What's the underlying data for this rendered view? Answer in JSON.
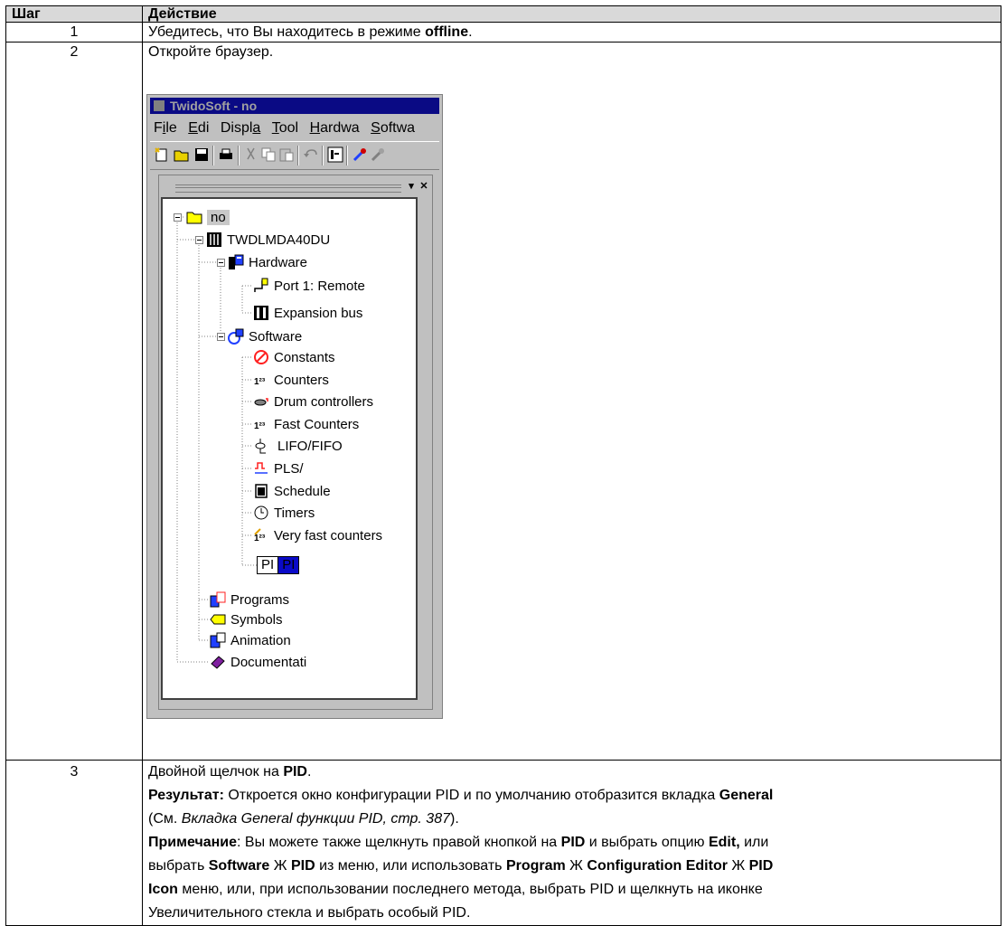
{
  "header": {
    "step": "Шаг",
    "action": "Действие"
  },
  "row1": {
    "num": "1",
    "t1": "Убедитесь, что Вы находитесь в режиме ",
    "b1": "offline",
    "t2": "."
  },
  "row2": {
    "num": "2",
    "text": "Откройте браузер.",
    "window": {
      "title": "TwidoSoft - no",
      "menu": [
        {
          "pre": "F",
          "u": "i",
          "post": "le"
        },
        {
          "pre": "",
          "u": "E",
          "post": "di"
        },
        {
          "pre": "Displ",
          "u": "a",
          "post": ""
        },
        {
          "pre": "",
          "u": "T",
          "post": "ool"
        },
        {
          "pre": "",
          "u": "H",
          "post": "ardwa"
        },
        {
          "pre": "",
          "u": "S",
          "post": "oftwa"
        }
      ],
      "tree": {
        "root": "no",
        "controller": "TWDLMDA40DU",
        "hardware": "Hardware",
        "port1": "Port 1: Remote",
        "expansion": "Expansion bus",
        "software": "Software",
        "constants": "Constants",
        "counters": "Counters",
        "drum": "Drum controllers",
        "fast": "Fast Counters",
        "lifo": "LIFO/FIFO",
        "pls": "PLS/",
        "schedule": "Schedule",
        "timers": "Timers",
        "vfc": "Very fast counters",
        "pid_a": "PI",
        "pid_b": "PI",
        "programs": "Programs",
        "symbols": "Symbols",
        "animation": "Animation",
        "documentation": "Documentati"
      }
    }
  },
  "row3": {
    "num": "3",
    "l1_t1": "Двойной щелчок на ",
    "l1_b1": "PID",
    "l1_t2": ".",
    "l2_b1": "Результат:",
    "l2_t1": " Откроется окно конфигурации PID и по умолчанию отобразится вкладка ",
    "l2_b2": "General",
    "l3_t1": "(См. ",
    "l3_i1": "Вкладка General функции PID, стр. 387",
    "l3_t2": ").",
    "l4_b1": "Примечание",
    "l4_t1": ": Вы можете также щелкнуть правой кнопкой на ",
    "l4_b2": "PID",
    "l4_t2": " и выбрать опцию ",
    "l4_b3": "Edit,",
    "l4_t3": " или",
    "l5_t1": "выбрать ",
    "l5_b1": "Software",
    "l5_t2": " Ж ",
    "l5_b2": "PID",
    "l5_t3": " из меню, или использовать ",
    "l5_b3": "Program",
    "l5_t4": " Ж ",
    "l5_b4": "Configuration Editor",
    "l5_t5": " Ж ",
    "l5_b5": "PID",
    "l6_b1": "Icon",
    "l6_t1": " меню, или, при использовании последнего метода, выбрать PID и щелкнуть на иконке",
    "l7_t1": "Увеличительного стекла и выбрать особый PID."
  }
}
